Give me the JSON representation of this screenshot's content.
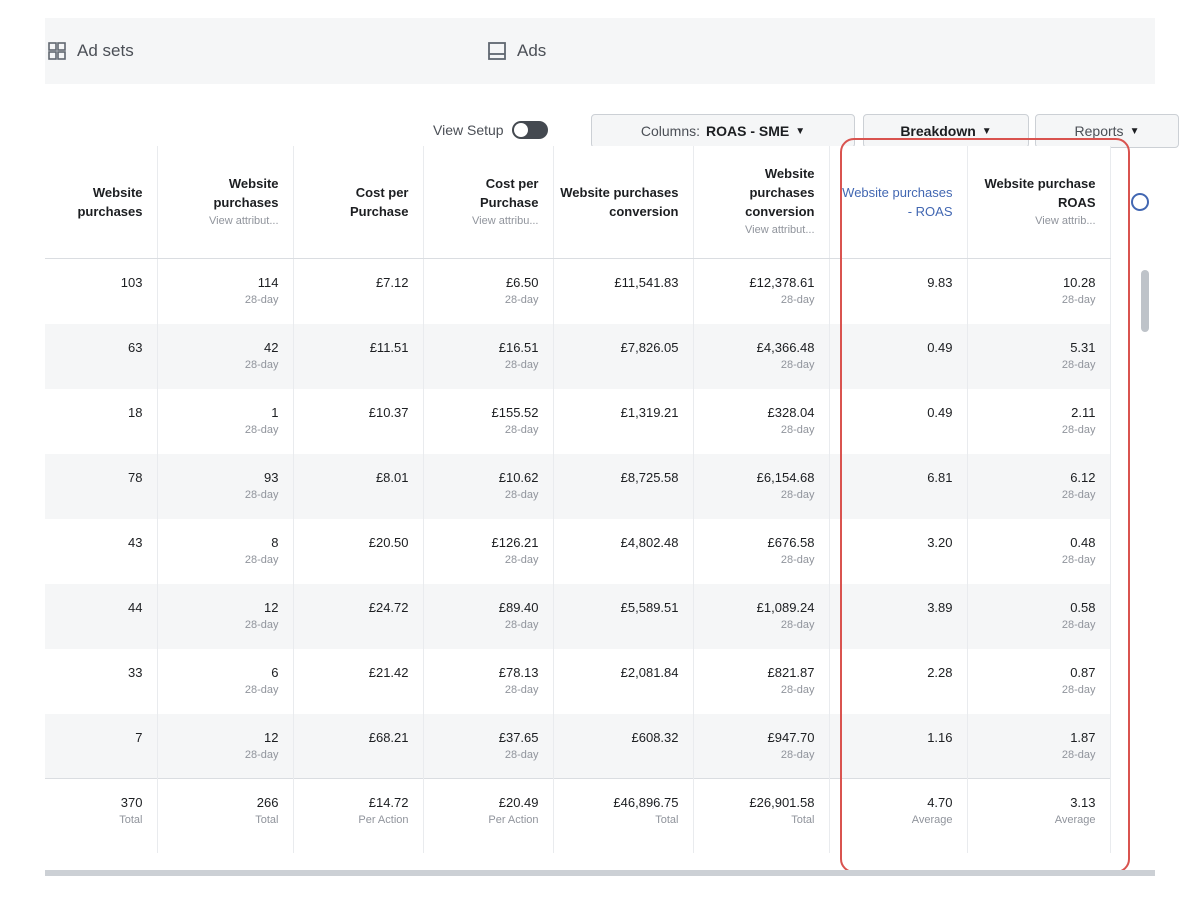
{
  "tabs": {
    "adsets": "Ad sets",
    "ads": "Ads"
  },
  "toolbar": {
    "view_setup": "View Setup",
    "columns_prefix": "Columns:",
    "columns_value": "ROAS - SME",
    "breakdown": "Breakdown",
    "reports": "Reports"
  },
  "headers": [
    {
      "title": "Website purchases",
      "sub": ""
    },
    {
      "title": "Website purchases",
      "sub": "View attribut..."
    },
    {
      "title": "Cost per Purchase",
      "sub": ""
    },
    {
      "title": "Cost per Purchase",
      "sub": "View attribu..."
    },
    {
      "title": "Website purchases conversion",
      "sub": ""
    },
    {
      "title": "Website purchases conversion",
      "sub": "View attribut..."
    },
    {
      "title": "Website purchases - ROAS",
      "sub": ""
    },
    {
      "title": "Website purchase ROAS",
      "sub": "View attrib..."
    }
  ],
  "rows": [
    [
      [
        "103",
        ""
      ],
      [
        "114",
        "28-day"
      ],
      [
        "£7.12",
        ""
      ],
      [
        "£6.50",
        "28-day"
      ],
      [
        "£11,541.83",
        ""
      ],
      [
        "£12,378.61",
        "28-day"
      ],
      [
        "9.83",
        ""
      ],
      [
        "10.28",
        "28-day"
      ]
    ],
    [
      [
        "63",
        ""
      ],
      [
        "42",
        "28-day"
      ],
      [
        "£11.51",
        ""
      ],
      [
        "£16.51",
        "28-day"
      ],
      [
        "£7,826.05",
        ""
      ],
      [
        "£4,366.48",
        "28-day"
      ],
      [
        "0.49",
        ""
      ],
      [
        "5.31",
        "28-day"
      ]
    ],
    [
      [
        "18",
        ""
      ],
      [
        "1",
        "28-day"
      ],
      [
        "£10.37",
        ""
      ],
      [
        "£155.52",
        "28-day"
      ],
      [
        "£1,319.21",
        ""
      ],
      [
        "£328.04",
        "28-day"
      ],
      [
        "0.49",
        ""
      ],
      [
        "2.11",
        "28-day"
      ]
    ],
    [
      [
        "78",
        ""
      ],
      [
        "93",
        "28-day"
      ],
      [
        "£8.01",
        ""
      ],
      [
        "£10.62",
        "28-day"
      ],
      [
        "£8,725.58",
        ""
      ],
      [
        "£6,154.68",
        "28-day"
      ],
      [
        "6.81",
        ""
      ],
      [
        "6.12",
        "28-day"
      ]
    ],
    [
      [
        "43",
        ""
      ],
      [
        "8",
        "28-day"
      ],
      [
        "£20.50",
        ""
      ],
      [
        "£126.21",
        "28-day"
      ],
      [
        "£4,802.48",
        ""
      ],
      [
        "£676.58",
        "28-day"
      ],
      [
        "3.20",
        ""
      ],
      [
        "0.48",
        "28-day"
      ]
    ],
    [
      [
        "44",
        ""
      ],
      [
        "12",
        "28-day"
      ],
      [
        "£24.72",
        ""
      ],
      [
        "£89.40",
        "28-day"
      ],
      [
        "£5,589.51",
        ""
      ],
      [
        "£1,089.24",
        "28-day"
      ],
      [
        "3.89",
        ""
      ],
      [
        "0.58",
        "28-day"
      ]
    ],
    [
      [
        "33",
        ""
      ],
      [
        "6",
        "28-day"
      ],
      [
        "£21.42",
        ""
      ],
      [
        "£78.13",
        "28-day"
      ],
      [
        "£2,081.84",
        ""
      ],
      [
        "£821.87",
        "28-day"
      ],
      [
        "2.28",
        ""
      ],
      [
        "0.87",
        "28-day"
      ]
    ],
    [
      [
        "7",
        ""
      ],
      [
        "12",
        "28-day"
      ],
      [
        "£68.21",
        ""
      ],
      [
        "£37.65",
        "28-day"
      ],
      [
        "£608.32",
        ""
      ],
      [
        "£947.70",
        "28-day"
      ],
      [
        "1.16",
        ""
      ],
      [
        "1.87",
        "28-day"
      ]
    ]
  ],
  "totals": [
    [
      "370",
      "Total"
    ],
    [
      "266",
      "Total"
    ],
    [
      "£14.72",
      "Per Action"
    ],
    [
      "£20.49",
      "Per Action"
    ],
    [
      "£46,896.75",
      "Total"
    ],
    [
      "£26,901.58",
      "Total"
    ],
    [
      "4.70",
      "Average"
    ],
    [
      "3.13",
      "Average"
    ]
  ],
  "colors": {
    "highlight": "#d9534f",
    "link": "#4267b2"
  }
}
